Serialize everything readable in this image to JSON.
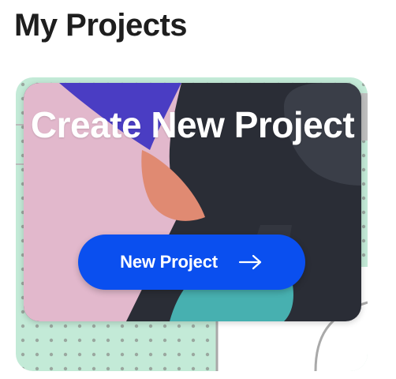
{
  "page": {
    "title": "My Projects"
  },
  "card": {
    "title": "Create New Project",
    "button_label": "New Project",
    "button_icon": "arrow-right-icon"
  },
  "colors": {
    "title_text": "#1e1e1e",
    "button_bg": "#0a4fef",
    "background_mint": "#c3ead7",
    "card_pink": "#e2b8cc",
    "card_dark": "#2a2d36",
    "card_purple": "#4a3dc3",
    "card_coral": "#e08a72",
    "card_teal": "#47b0b0"
  }
}
